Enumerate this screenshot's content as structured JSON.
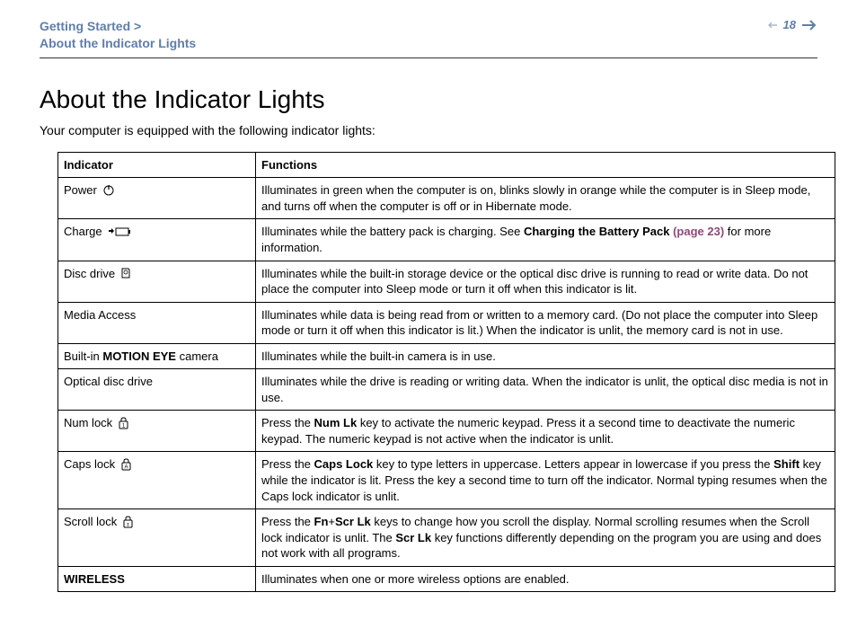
{
  "header": {
    "breadcrumb_line1": "Getting Started >",
    "breadcrumb_line2": "About the Indicator Lights",
    "page_number": "18"
  },
  "title": "About the Indicator Lights",
  "intro": "Your computer is equipped with the following indicator lights:",
  "table": {
    "col1": "Indicator",
    "col2": "Functions",
    "rows": [
      {
        "indicator_pre": "Power ",
        "icon": "power-icon",
        "func": "Illuminates in green when the computer is on, blinks slowly in orange while the computer is in Sleep mode, and turns off when the computer is off or in Hibernate mode."
      },
      {
        "indicator_pre": "Charge ",
        "icon": "charge-icon",
        "func_pre": "Illuminates while the battery pack is charging. See ",
        "link_text": "Charging the Battery Pack ",
        "link_page": "(page 23)",
        "func_post": " for more information."
      },
      {
        "indicator_pre": "Disc drive ",
        "icon": "disc-icon",
        "func": "Illuminates while the built-in storage device or the optical disc drive is running to read or write data. Do not place the computer into Sleep mode or turn it off when this indicator is lit."
      },
      {
        "indicator_pre": "Media Access",
        "icon": null,
        "func": "Illuminates while data is being read from or written to a memory card. (Do not place the computer into Sleep mode or turn it off when this indicator is lit.) When the indicator is unlit, the memory card is not in use."
      },
      {
        "indicator_pre": "Built-in ",
        "indicator_bold": "MOTION EYE",
        "indicator_post": " camera",
        "icon": null,
        "func": "Illuminates while the built-in camera is in use."
      },
      {
        "indicator_pre": "Optical disc drive",
        "icon": null,
        "func": "Illuminates while the drive is reading or writing data. When the indicator is unlit, the optical disc media is not in use."
      },
      {
        "indicator_pre": "Num lock ",
        "icon": "numlock-icon",
        "func_pre": "Press the ",
        "b1": "Num Lk",
        "func_post": " key to activate the numeric keypad. Press it a second time to deactivate the numeric keypad. The numeric keypad is not active when the indicator is unlit."
      },
      {
        "indicator_pre": "Caps lock ",
        "icon": "capslock-icon",
        "func_pre": "Press the ",
        "b1": "Caps Lock",
        "func_mid": " key to type letters in uppercase. Letters appear in lowercase if you press the ",
        "b2": "Shift",
        "func_post": " key while the indicator is lit. Press the key a second time to turn off the indicator. Normal typing resumes when the Caps lock indicator is unlit."
      },
      {
        "indicator_pre": "Scroll lock ",
        "icon": "scrolllock-icon",
        "func_pre": "Press the ",
        "b1": "Fn",
        "plus": "+",
        "b2": "Scr Lk",
        "func_mid": " keys to change how you scroll the display. Normal scrolling resumes when the Scroll lock indicator is unlit. The ",
        "b3": "Scr Lk",
        "func_post": " key functions differently depending on the program you are using and does not work with all programs."
      },
      {
        "indicator_bold_only": "WIRELESS",
        "icon": null,
        "func": "Illuminates when one or more wireless options are enabled."
      }
    ]
  }
}
